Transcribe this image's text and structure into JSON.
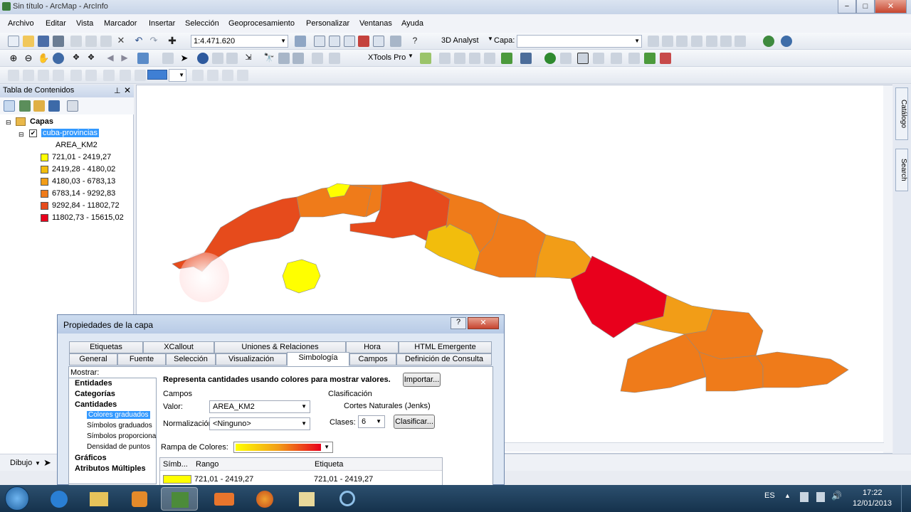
{
  "window": {
    "title": "Sin título - ArcMap - ArcInfo",
    "minimize": "−",
    "maximize": "□",
    "close": "✕"
  },
  "menubar": {
    "items": [
      "Archivo",
      "Editar",
      "Vista",
      "Marcador",
      "Insertar",
      "Selección",
      "Geoprocesamiento",
      "Personalizar",
      "Ventanas",
      "Ayuda"
    ]
  },
  "toolbar1": {
    "scale": "1:4.471.620",
    "analyst": "3D Analyst",
    "layer_label": "Capa:",
    "layer_value": ""
  },
  "toolbar2": {
    "xtools": "XTools Pro"
  },
  "toc": {
    "title": "Tabla de Contenidos",
    "root": "Capas",
    "layer": "cuba-provincias",
    "field": "AREA_KM2",
    "legend": [
      {
        "label": "721,01 - 2419,27",
        "color": "#ffff00"
      },
      {
        "label": "2419,28 - 4180,02",
        "color": "#f2bd0c"
      },
      {
        "label": "4180,03 - 6783,13",
        "color": "#f29d17"
      },
      {
        "label": "6783,14 - 9292,83",
        "color": "#ef7b1a"
      },
      {
        "label": "9292,84 - 11802,72",
        "color": "#e64b1c"
      },
      {
        "label": "11802,73 - 15615,02",
        "color": "#e8001c"
      }
    ]
  },
  "right_pane": {
    "catalog": "Catálogo",
    "search": "Search"
  },
  "drawbar": {
    "label": "Dibujo"
  },
  "dialog": {
    "title": "Propiedades de la capa",
    "tabs_row1": [
      "Etiquetas",
      "XCallout",
      "Uniones & Relaciones",
      "Hora",
      "HTML Emergente"
    ],
    "tabs_row2": [
      "General",
      "Fuente",
      "Selección",
      "Visualización",
      "Simbología",
      "Campos",
      "Definición de Consulta"
    ],
    "show_label": "Mostrar:",
    "show_items": [
      {
        "label": "Entidades",
        "bold": true
      },
      {
        "label": "Categorías",
        "bold": true
      },
      {
        "label": "Cantidades",
        "bold": true
      },
      {
        "label": "Colores graduados",
        "sub": true,
        "selected": true
      },
      {
        "label": "Símbolos graduados",
        "sub": true
      },
      {
        "label": "Símbolos proporciona",
        "sub": true
      },
      {
        "label": "Densidad de puntos",
        "sub": true
      },
      {
        "label": "Gráficos",
        "bold": true
      },
      {
        "label": "Atributos Múltiples",
        "bold": true
      }
    ],
    "description": "Representa cantidades usando colores para mostrar valores.",
    "import_button": "Importar...",
    "fields_group": "Campos",
    "value_label": "Valor:",
    "value": "AREA_KM2",
    "normalization_label": "Normalización:",
    "normalization": "<Ninguno>",
    "classification_group": "Clasificación",
    "method": "Cortes Naturales (Jenks)",
    "classes_label": "Clases:",
    "classes": "6",
    "classify_button": "Clasificar...",
    "ramp_label": "Rampa de Colores:",
    "col_symbol": "Símb...",
    "col_range": "Rango",
    "col_label": "Etiqueta",
    "first_row": {
      "range": "721,01 - 2419,27",
      "label": "721,01 - 2419,27",
      "color": "#ffff00"
    }
  },
  "taskbar": {
    "lang": "ES",
    "time": "17:22",
    "date": "12/01/2013"
  }
}
